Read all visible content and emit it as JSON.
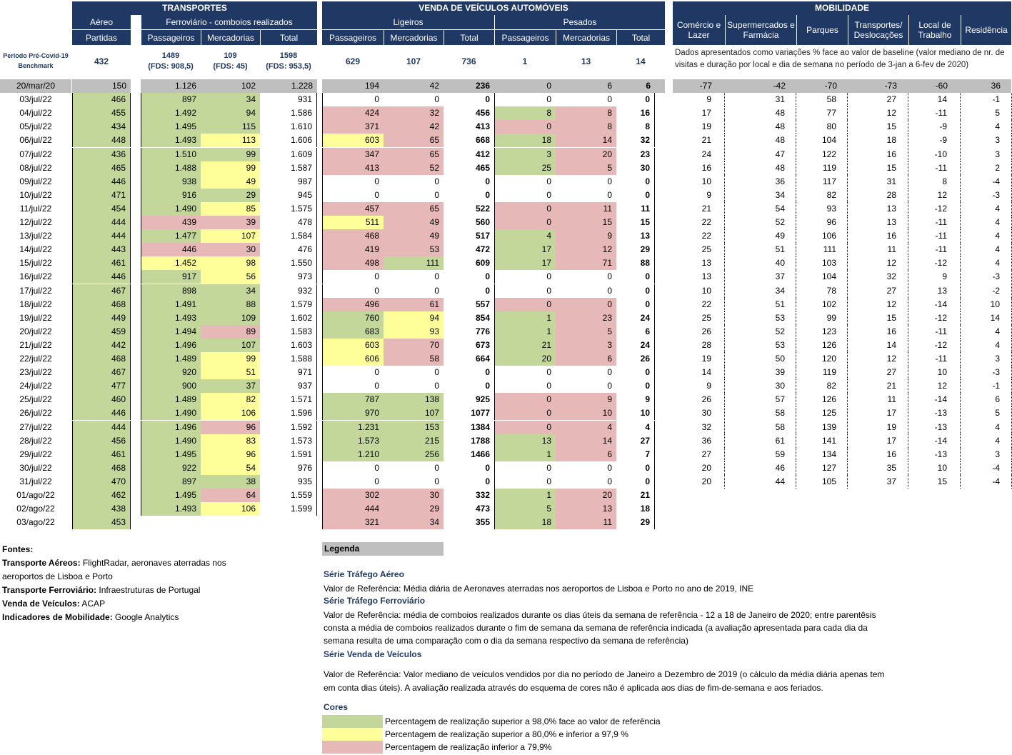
{
  "headers": {
    "transportes": "TRANSPORTES",
    "venda": "VENDA DE VEÍCULOS AUTOMÓVEIS",
    "mobilidade": "MOBILIDADE",
    "aereo": "Aéreo",
    "partidas": "Partidas",
    "ferroviario": "Ferroviário - comboios realizados",
    "passageiros": "Passageiros",
    "mercadorias": "Mercadorias",
    "total": "Total",
    "ligeiros": "Ligeiros",
    "pesados": "Pesados",
    "mob_cols": [
      "Comércio e Lazer",
      "Supermercados e Farmácia",
      "Parques",
      "Transportes/ Deslocações",
      "Local de Trabalho",
      "Residência"
    ]
  },
  "benchmark": {
    "label": "Período Pré-Covid-19 Benchmark",
    "aereo": "432",
    "passageiros": "1489",
    "passageiros_fds": "(FDS: 908,5)",
    "mercadorias": "109",
    "mercadorias_fds": "(FDS: 45)",
    "total": "1598",
    "total_fds": "(FDS: 953,5)",
    "lig_pass": "629",
    "lig_merc": "107",
    "lig_total": "736",
    "pes_pass": "1",
    "pes_merc": "13",
    "pes_total": "14",
    "mob_note": "Dados apresentados como variações % face ao valor de baseline (valor mediano de nr. de visitas e duração por local e dia de semana no período de 3-jan a 6-fev de 2020)"
  },
  "rows": [
    {
      "d": "20/mar/20",
      "a": "150",
      "fp": "1.126",
      "fm": "102",
      "ft": "1.228",
      "lp": "194",
      "lm": "42",
      "lt": "236",
      "pp": "0",
      "pm": "6",
      "pt": "6",
      "m": [
        "-77",
        "-42",
        "-70",
        "-73",
        "-60",
        "36"
      ]
    },
    {
      "d": "03/jul/22",
      "a": "466",
      "ac": "g",
      "fp": "897",
      "fpc": "g",
      "fm": "34",
      "fmc": "g",
      "ft": "931",
      "lp": "0",
      "lm": "0",
      "lt": "0",
      "pp": "0",
      "pm": "0",
      "pt": "0",
      "m": [
        "9",
        "31",
        "58",
        "27",
        "14",
        "-1"
      ]
    },
    {
      "d": "04/jul/22",
      "a": "455",
      "ac": "g",
      "fp": "1.492",
      "fpc": "g",
      "fm": "94",
      "fmc": "g",
      "ft": "1.586",
      "lp": "424",
      "lpc": "r",
      "lm": "32",
      "lmc": "r",
      "lt": "456",
      "pp": "8",
      "ppc": "g",
      "pm": "8",
      "pmc": "r",
      "pt": "16",
      "m": [
        "17",
        "48",
        "77",
        "12",
        "-11",
        "5"
      ]
    },
    {
      "d": "05/jul/22",
      "a": "434",
      "ac": "g",
      "fp": "1.495",
      "fpc": "g",
      "fm": "115",
      "fmc": "g",
      "ft": "1.610",
      "lp": "371",
      "lpc": "r",
      "lm": "42",
      "lmc": "r",
      "lt": "413",
      "pp": "0",
      "ppc": "r",
      "pm": "8",
      "pmc": "r",
      "pt": "8",
      "m": [
        "19",
        "48",
        "80",
        "15",
        "-9",
        "4"
      ]
    },
    {
      "d": "06/jul/22",
      "a": "448",
      "ac": "g",
      "fp": "1.493",
      "fpc": "g",
      "fm": "113",
      "fmc": "y",
      "ft": "1.606",
      "lp": "603",
      "lpc": "y",
      "lm": "65",
      "lmc": "r",
      "lt": "668",
      "pp": "18",
      "ppc": "g",
      "pm": "14",
      "pmc": "r",
      "pt": "32",
      "m": [
        "21",
        "48",
        "104",
        "18",
        "-9",
        "3"
      ]
    },
    {
      "d": "07/jul/22",
      "a": "436",
      "ac": "g",
      "fp": "1.510",
      "fpc": "g",
      "fm": "99",
      "fmc": "g",
      "ft": "1.609",
      "lp": "347",
      "lpc": "r",
      "lm": "65",
      "lmc": "r",
      "lt": "412",
      "pp": "3",
      "ppc": "g",
      "pm": "20",
      "pmc": "r",
      "pt": "23",
      "m": [
        "24",
        "47",
        "122",
        "16",
        "-10",
        "3"
      ]
    },
    {
      "d": "08/jul/22",
      "a": "465",
      "ac": "g",
      "fp": "1.488",
      "fpc": "g",
      "fm": "99",
      "fmc": "y",
      "ft": "1.587",
      "lp": "413",
      "lpc": "r",
      "lm": "52",
      "lmc": "r",
      "lt": "465",
      "pp": "25",
      "ppc": "g",
      "pm": "5",
      "pmc": "r",
      "pt": "30",
      "m": [
        "16",
        "48",
        "119",
        "15",
        "-11",
        "2"
      ]
    },
    {
      "d": "09/jul/22",
      "a": "446",
      "ac": "g",
      "fp": "938",
      "fpc": "g",
      "fm": "49",
      "fmc": "y",
      "ft": "987",
      "lp": "0",
      "lm": "0",
      "lt": "0",
      "pp": "0",
      "pm": "0",
      "pt": "0",
      "m": [
        "10",
        "36",
        "117",
        "31",
        "8",
        "-4"
      ]
    },
    {
      "d": "10/jul/22",
      "a": "471",
      "ac": "g",
      "fp": "916",
      "fpc": "g",
      "fm": "29",
      "fmc": "g",
      "ft": "945",
      "lp": "0",
      "lm": "0",
      "lt": "0",
      "pp": "0",
      "pm": "0",
      "pt": "0",
      "m": [
        "9",
        "34",
        "82",
        "28",
        "12",
        "-3"
      ]
    },
    {
      "d": "11/jul/22",
      "a": "454",
      "ac": "g",
      "fp": "1.490",
      "fpc": "g",
      "fm": "85",
      "fmc": "y",
      "ft": "1.575",
      "lp": "457",
      "lpc": "r",
      "lm": "65",
      "lmc": "r",
      "lt": "522",
      "pp": "0",
      "ppc": "r",
      "pm": "11",
      "pmc": "r",
      "pt": "11",
      "m": [
        "21",
        "54",
        "93",
        "13",
        "-12",
        "4"
      ]
    },
    {
      "d": "12/jul/22",
      "a": "444",
      "ac": "g",
      "fp": "439",
      "fpc": "r",
      "fm": "39",
      "fmc": "r",
      "ft": "478",
      "lp": "511",
      "lpc": "y",
      "lm": "49",
      "lmc": "r",
      "lt": "560",
      "pp": "0",
      "ppc": "r",
      "pm": "15",
      "pmc": "r",
      "pt": "15",
      "m": [
        "22",
        "52",
        "96",
        "13",
        "-11",
        "4"
      ]
    },
    {
      "d": "13/jul/22",
      "a": "444",
      "ac": "g",
      "fp": "1.477",
      "fpc": "g",
      "fm": "107",
      "fmc": "y",
      "ft": "1.584",
      "lp": "468",
      "lpc": "r",
      "lm": "49",
      "lmc": "r",
      "lt": "517",
      "pp": "4",
      "ppc": "g",
      "pm": "9",
      "pmc": "r",
      "pt": "13",
      "m": [
        "22",
        "49",
        "106",
        "16",
        "-11",
        "4"
      ]
    },
    {
      "d": "14/jul/22",
      "a": "443",
      "ac": "g",
      "fp": "446",
      "fpc": "r",
      "fm": "30",
      "fmc": "r",
      "ft": "476",
      "lp": "419",
      "lpc": "r",
      "lm": "53",
      "lmc": "r",
      "lt": "472",
      "pp": "17",
      "ppc": "g",
      "pm": "12",
      "pmc": "r",
      "pt": "29",
      "m": [
        "25",
        "51",
        "111",
        "11",
        "-11",
        "4"
      ]
    },
    {
      "d": "15/jul/22",
      "a": "461",
      "ac": "g",
      "fp": "1.452",
      "fpc": "y",
      "fm": "98",
      "fmc": "y",
      "ft": "1.550",
      "lp": "498",
      "lpc": "r",
      "lm": "111",
      "lmc": "g",
      "lt": "609",
      "pp": "17",
      "ppc": "g",
      "pm": "71",
      "pmc": "r",
      "pt": "88",
      "m": [
        "13",
        "40",
        "103",
        "12",
        "-12",
        "4"
      ]
    },
    {
      "d": "16/jul/22",
      "a": "446",
      "ac": "g",
      "fp": "917",
      "fpc": "g",
      "fm": "56",
      "fmc": "y",
      "ft": "973",
      "lp": "0",
      "lm": "0",
      "lt": "0",
      "pp": "0",
      "pm": "0",
      "pt": "0",
      "m": [
        "13",
        "37",
        "104",
        "32",
        "9",
        "-3"
      ]
    },
    {
      "d": "17/jul/22",
      "a": "467",
      "ac": "g",
      "fp": "898",
      "fpc": "g",
      "fm": "34",
      "fmc": "g",
      "ft": "932",
      "lp": "0",
      "lm": "0",
      "lt": "0",
      "pp": "0",
      "pm": "0",
      "pt": "0",
      "m": [
        "10",
        "34",
        "78",
        "27",
        "13",
        "-2"
      ]
    },
    {
      "d": "18/jul/22",
      "a": "468",
      "ac": "g",
      "fp": "1.491",
      "fpc": "g",
      "fm": "88",
      "fmc": "g",
      "ft": "1.579",
      "lp": "496",
      "lpc": "r",
      "lm": "61",
      "lmc": "r",
      "lt": "557",
      "pp": "0",
      "ppc": "r",
      "pm": "0",
      "pmc": "r",
      "pt": "0",
      "m": [
        "22",
        "51",
        "102",
        "12",
        "-14",
        "10"
      ]
    },
    {
      "d": "19/jul/22",
      "a": "449",
      "ac": "g",
      "fp": "1.493",
      "fpc": "g",
      "fm": "109",
      "fmc": "g",
      "ft": "1.602",
      "lp": "760",
      "lpc": "g",
      "lm": "94",
      "lmc": "y",
      "lt": "854",
      "pp": "1",
      "ppc": "g",
      "pm": "23",
      "pmc": "r",
      "pt": "24",
      "m": [
        "25",
        "53",
        "99",
        "15",
        "-12",
        "14"
      ]
    },
    {
      "d": "20/jul/22",
      "a": "459",
      "ac": "g",
      "fp": "1.494",
      "fpc": "g",
      "fm": "89",
      "fmc": "r",
      "ft": "1.583",
      "lp": "683",
      "lpc": "g",
      "lm": "93",
      "lmc": "y",
      "lt": "776",
      "pp": "1",
      "ppc": "g",
      "pm": "5",
      "pmc": "r",
      "pt": "6",
      "m": [
        "26",
        "52",
        "123",
        "16",
        "-11",
        "4"
      ]
    },
    {
      "d": "21/jul/22",
      "a": "442",
      "ac": "g",
      "fp": "1.496",
      "fpc": "g",
      "fm": "107",
      "fmc": "g",
      "ft": "1.603",
      "lp": "603",
      "lpc": "y",
      "lm": "70",
      "lmc": "r",
      "lt": "673",
      "pp": "21",
      "ppc": "g",
      "pm": "3",
      "pmc": "r",
      "pt": "24",
      "m": [
        "28",
        "53",
        "126",
        "14",
        "-12",
        "4"
      ]
    },
    {
      "d": "22/jul/22",
      "a": "468",
      "ac": "g",
      "fp": "1.489",
      "fpc": "g",
      "fm": "99",
      "fmc": "y",
      "ft": "1.588",
      "lp": "606",
      "lpc": "y",
      "lm": "58",
      "lmc": "r",
      "lt": "664",
      "pp": "20",
      "ppc": "g",
      "pm": "6",
      "pmc": "r",
      "pt": "26",
      "m": [
        "19",
        "50",
        "120",
        "12",
        "-11",
        "3"
      ]
    },
    {
      "d": "23/jul/22",
      "a": "467",
      "ac": "g",
      "fp": "920",
      "fpc": "g",
      "fm": "51",
      "fmc": "y",
      "ft": "971",
      "lp": "0",
      "lm": "0",
      "lt": "0",
      "pp": "0",
      "pm": "0",
      "pt": "0",
      "m": [
        "14",
        "39",
        "119",
        "27",
        "10",
        "-3"
      ]
    },
    {
      "d": "24/jul/22",
      "a": "477",
      "ac": "g",
      "fp": "900",
      "fpc": "g",
      "fm": "37",
      "fmc": "g",
      "ft": "937",
      "lp": "0",
      "lm": "0",
      "lt": "0",
      "pp": "0",
      "pm": "0",
      "pt": "0",
      "m": [
        "9",
        "30",
        "82",
        "21",
        "12",
        "-1"
      ]
    },
    {
      "d": "25/jul/22",
      "a": "460",
      "ac": "g",
      "fp": "1.489",
      "fpc": "g",
      "fm": "82",
      "fmc": "y",
      "ft": "1.571",
      "lp": "787",
      "lpc": "g",
      "lm": "138",
      "lmc": "g",
      "lt": "925",
      "pp": "0",
      "ppc": "r",
      "pm": "9",
      "pmc": "r",
      "pt": "9",
      "m": [
        "26",
        "57",
        "126",
        "11",
        "-14",
        "6"
      ]
    },
    {
      "d": "26/jul/22",
      "a": "446",
      "ac": "g",
      "fp": "1.490",
      "fpc": "g",
      "fm": "106",
      "fmc": "y",
      "ft": "1.596",
      "lp": "970",
      "lpc": "g",
      "lm": "107",
      "lmc": "g",
      "lt": "1077",
      "pp": "0",
      "ppc": "r",
      "pm": "10",
      "pmc": "r",
      "pt": "10",
      "m": [
        "30",
        "58",
        "125",
        "17",
        "-13",
        "5"
      ]
    },
    {
      "d": "27/jul/22",
      "a": "444",
      "ac": "g",
      "fp": "1.496",
      "fpc": "g",
      "fm": "96",
      "fmc": "r",
      "ft": "1.592",
      "lp": "1.231",
      "lpc": "g",
      "lm": "153",
      "lmc": "g",
      "lt": "1384",
      "pp": "0",
      "ppc": "r",
      "pm": "4",
      "pmc": "r",
      "pt": "4",
      "m": [
        "32",
        "58",
        "139",
        "19",
        "-13",
        "4"
      ]
    },
    {
      "d": "28/jul/22",
      "a": "456",
      "ac": "g",
      "fp": "1.490",
      "fpc": "g",
      "fm": "83",
      "fmc": "y",
      "ft": "1.573",
      "lp": "1.573",
      "lpc": "g",
      "lm": "215",
      "lmc": "g",
      "lt": "1788",
      "pp": "13",
      "ppc": "g",
      "pm": "14",
      "pmc": "r",
      "pt": "27",
      "m": [
        "36",
        "61",
        "141",
        "17",
        "-14",
        "4"
      ]
    },
    {
      "d": "29/jul/22",
      "a": "461",
      "ac": "g",
      "fp": "1.495",
      "fpc": "g",
      "fm": "96",
      "fmc": "y",
      "ft": "1.591",
      "lp": "1.210",
      "lpc": "g",
      "lm": "256",
      "lmc": "g",
      "lt": "1466",
      "pp": "1",
      "ppc": "g",
      "pm": "6",
      "pmc": "r",
      "pt": "7",
      "m": [
        "27",
        "59",
        "134",
        "16",
        "-13",
        "3"
      ]
    },
    {
      "d": "30/jul/22",
      "a": "468",
      "ac": "g",
      "fp": "922",
      "fpc": "g",
      "fm": "54",
      "fmc": "y",
      "ft": "976",
      "lp": "0",
      "lm": "0",
      "lt": "0",
      "pp": "0",
      "pm": "0",
      "pt": "0",
      "m": [
        "20",
        "46",
        "127",
        "35",
        "10",
        "-4"
      ]
    },
    {
      "d": "31/jul/22",
      "a": "470",
      "ac": "g",
      "fp": "897",
      "fpc": "g",
      "fm": "38",
      "fmc": "g",
      "ft": "935",
      "lp": "0",
      "lm": "0",
      "lt": "0",
      "pp": "0",
      "pm": "0",
      "pt": "0",
      "m": [
        "20",
        "44",
        "105",
        "37",
        "15",
        "-4"
      ]
    },
    {
      "d": "01/ago/22",
      "a": "462",
      "ac": "g",
      "fp": "1.495",
      "fpc": "g",
      "fm": "64",
      "fmc": "r",
      "ft": "1.559",
      "lp": "302",
      "lpc": "r",
      "lm": "30",
      "lmc": "r",
      "lt": "332",
      "pp": "1",
      "ppc": "g",
      "pm": "20",
      "pmc": "r",
      "pt": "21"
    },
    {
      "d": "02/ago/22",
      "a": "438",
      "ac": "g",
      "fp": "1.493",
      "fpc": "g",
      "fm": "106",
      "fmc": "y",
      "ft": "1.599",
      "lp": "444",
      "lpc": "r",
      "lm": "29",
      "lmc": "r",
      "lt": "473",
      "pp": "5",
      "ppc": "g",
      "pm": "13",
      "pmc": "r",
      "pt": "18"
    },
    {
      "d": "03/ago/22",
      "a": "453",
      "ac": "g",
      "lp": "321",
      "lpc": "r",
      "lm": "34",
      "lmc": "r",
      "lt": "355",
      "pp": "18",
      "ppc": "g",
      "pm": "11",
      "pmc": "r",
      "pt": "29"
    }
  ],
  "sources": {
    "title": "Fontes:",
    "lines": [
      {
        "label": "Transporte Aéreos:",
        "text": " FlightRadar, aeronaves aterradas nos"
      },
      {
        "label": "",
        "text": "aeroportos de Lisboa e Porto"
      },
      {
        "label": "Transporte Ferroviário:",
        "text": " Infraestruturas de Portugal"
      },
      {
        "label": "Venda de Veículos:",
        "text": " ACAP"
      },
      {
        "label": "Indicadores de Mobilidade:",
        "text": " Google Analytics"
      }
    ]
  },
  "legend": {
    "title": "Legenda",
    "aereo_h": "Série Tráfego Aéreo",
    "aereo_t": "Valor de Referência: Média diária de Aeronaves aterradas nos aeroportos de Lisboa e Porto no ano de 2019, INE",
    "ferro_h": "Série Tráfego Ferroviário",
    "ferro_t1": "Valor de Referência: média de comboios realizados durante os dias úteis da semana de referência - 12 a 18 de Janeiro de 2020; entre parentêsis",
    "ferro_t2": "consta a média de comboios realizados durante o fim de semana da semana de referência indicada (a avaliação apresentada para cada dia da",
    "ferro_t3": "semana resulta de uma comparação com o dia da semana respectivo da semana de referência)",
    "venda_h": "Série Venda de Veículos",
    "venda_t1": "Valor de Referência: Valor mediano de veículos vendidos por dia no período de Janeiro a Dezembro de 2019 (o cálculo da média diária apenas tem",
    "venda_t2": "em conta dias úteis). A avaliação realizada através do esquema de cores não é aplicada aos dias de fim-de-semana e aos feriados.",
    "cores_h": "Cores",
    "cores": [
      {
        "color": "#c4d79b",
        "text": "Percentagem de realização superior a 98,0% face ao valor de referência"
      },
      {
        "color": "#ffff99",
        "text": "Percentagem de realização superior a 80,0% e inferior a 97,9 %"
      },
      {
        "color": "#e6b8b7",
        "text": "Percentagem de realização inferior a 79,9%"
      }
    ]
  }
}
